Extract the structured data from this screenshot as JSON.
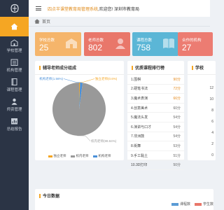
{
  "sidebar": {
    "items": [
      {
        "label": "",
        "icon": "home-icon",
        "active": true
      },
      {
        "label": "学校管理",
        "icon": "school-icon"
      },
      {
        "label": "机构管理",
        "icon": "organization-icon"
      },
      {
        "label": "课程管理",
        "icon": "book-icon"
      },
      {
        "label": "师资管理",
        "icon": "teacher-icon"
      },
      {
        "label": "总结报告",
        "icon": "report-icon"
      }
    ]
  },
  "header": {
    "system_name": "四点半课堂教育局管理系统",
    "welcome": ",欢迎您! 深圳市教育局"
  },
  "breadcrumb": {
    "home": "首页"
  },
  "stats": [
    {
      "label": "学校总数",
      "value": "25",
      "color": "#f5b56b",
      "icon": "school-icon"
    },
    {
      "label": "老师总数",
      "value": "802",
      "color": "#e9776a",
      "icon": "teacher-icon"
    },
    {
      "label": "课程总数",
      "value": "758",
      "color": "#5bb6d6",
      "icon": "book-icon"
    },
    {
      "label": "合作的机构",
      "value": "27",
      "color": "#ec7c72",
      "icon": "organization-icon"
    }
  ],
  "teacher_panel": {
    "title": "辅导老师成分组成"
  },
  "chart_data": {
    "type": "pie",
    "title": "辅导老师成分组成",
    "slices": [
      {
        "name": "独立老师",
        "value": 0.6,
        "color": "#f5a623"
      },
      {
        "name": "机构老师",
        "value": 1.56,
        "color": "#4a90d9"
      },
      {
        "name": "校内老师",
        "value": 98.84,
        "color": "#999999"
      }
    ],
    "slice_labels": [
      "独立老师(0.6%)",
      "机构老师(1.56%)",
      "校内老师(98.84%)"
    ],
    "legend": [
      "独立老师",
      "校内老师",
      "机构老师"
    ]
  },
  "ranking": {
    "title": "优质课程排行榜",
    "rows": [
      {
        "name": "1.围棋",
        "score": "90分",
        "top": true
      },
      {
        "name": "2.硬笔书法",
        "score": "72分",
        "top": true
      },
      {
        "name": "3.魔术表演",
        "score": "66分",
        "top": true
      },
      {
        "name": "4.创意美术",
        "score": "60分",
        "top": false
      },
      {
        "name": "5.魔法头发",
        "score": "54分",
        "top": false
      },
      {
        "name": "6.演讲与口才",
        "score": "54分",
        "top": false
      },
      {
        "name": "7.非洲鼓",
        "score": "54分",
        "top": false
      },
      {
        "name": "8.街舞",
        "score": "53分",
        "top": false
      },
      {
        "name": "9.手工黏土",
        "score": "51分",
        "top": false
      },
      {
        "name": "10.3D打印",
        "score": "50分",
        "top": false
      }
    ]
  },
  "right_panel": {
    "title": "学校",
    "ticks": [
      "12",
      "10",
      "8",
      "6",
      "4",
      "2",
      "0"
    ]
  },
  "today": {
    "title": "今日数据",
    "legend": [
      {
        "label": "课程数",
        "color": "#5b9bd5"
      },
      {
        "label": "学生数",
        "color": "#e9776a"
      }
    ]
  },
  "colors": {
    "accent": "#f5a623",
    "sidebar": "#2b3445"
  }
}
